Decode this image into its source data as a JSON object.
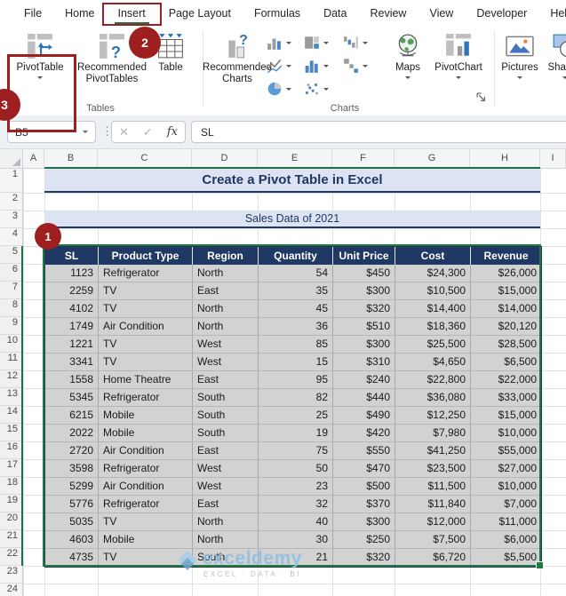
{
  "ribbon": {
    "tabs": [
      "File",
      "Home",
      "Insert",
      "Page Layout",
      "Formulas",
      "Data",
      "Review",
      "View",
      "Developer",
      "Help"
    ],
    "active_tab": "Insert",
    "groups": {
      "tables": {
        "label": "Tables",
        "pivot_table": "PivotTable",
        "recommended_pivottables": "Recommended PivotTables",
        "table": "Table"
      },
      "charts": {
        "label": "Charts",
        "recommended_charts": "Recommended Charts",
        "maps": "Maps",
        "pivot_chart": "PivotChart"
      },
      "illustrations": {
        "pictures": "Pictures",
        "shapes": "Shapes"
      }
    },
    "annotations": {
      "step1": "1",
      "step2": "2",
      "step3": "3"
    }
  },
  "formula_bar": {
    "name_box": "B5",
    "cancel_icon": "✕",
    "enter_icon": "✓",
    "fx_label": "fx",
    "formula": "SL",
    "dots_icon": "⋮"
  },
  "grid": {
    "column_headers": [
      "A",
      "B",
      "C",
      "D",
      "E",
      "F",
      "G",
      "H",
      "I"
    ],
    "row_count": 24,
    "title": "Create a Pivot Table in Excel",
    "subtitle": "Sales Data of 2021"
  },
  "table": {
    "headers": [
      "SL",
      "Product Type",
      "Region",
      "Quantity",
      "Unit Price",
      "Cost",
      "Revenue"
    ],
    "rows": [
      [
        "1123",
        "Refrigerator",
        "North",
        "54",
        "$450",
        "$24,300",
        "$26,000"
      ],
      [
        "2259",
        "TV",
        "East",
        "35",
        "$300",
        "$10,500",
        "$15,000"
      ],
      [
        "4102",
        "TV",
        "North",
        "45",
        "$320",
        "$14,400",
        "$14,000"
      ],
      [
        "1749",
        "Air Condition",
        "North",
        "36",
        "$510",
        "$18,360",
        "$20,120"
      ],
      [
        "1221",
        "TV",
        "West",
        "85",
        "$300",
        "$25,500",
        "$28,500"
      ],
      [
        "3341",
        "TV",
        "West",
        "15",
        "$310",
        "$4,650",
        "$6,500"
      ],
      [
        "1558",
        "Home Theatre",
        "East",
        "95",
        "$240",
        "$22,800",
        "$22,000"
      ],
      [
        "5345",
        "Refrigerator",
        "South",
        "82",
        "$440",
        "$36,080",
        "$33,000"
      ],
      [
        "6215",
        "Mobile",
        "South",
        "25",
        "$490",
        "$12,250",
        "$15,000"
      ],
      [
        "2022",
        "Mobile",
        "South",
        "19",
        "$420",
        "$7,980",
        "$10,000"
      ],
      [
        "2720",
        "Air Condition",
        "East",
        "75",
        "$550",
        "$41,250",
        "$55,000"
      ],
      [
        "3598",
        "Refrigerator",
        "West",
        "50",
        "$470",
        "$23,500",
        "$27,000"
      ],
      [
        "5299",
        "Air Condition",
        "West",
        "23",
        "$500",
        "$11,500",
        "$10,000"
      ],
      [
        "5776",
        "Refrigerator",
        "East",
        "32",
        "$370",
        "$11,840",
        "$7,000"
      ],
      [
        "5035",
        "TV",
        "North",
        "40",
        "$300",
        "$12,000",
        "$11,000"
      ],
      [
        "4603",
        "Mobile",
        "North",
        "30",
        "$250",
        "$7,500",
        "$6,000"
      ],
      [
        "4735",
        "TV",
        "South",
        "21",
        "$320",
        "$6,720",
        "$5,500"
      ]
    ]
  },
  "watermark": {
    "brand": "exceldemy",
    "tagline": "EXCEL · DATA · BI"
  },
  "colors": {
    "accent_green": "#1e7145",
    "annotation_red": "#9e1f1f",
    "header_navy": "#1f3864",
    "band_lavender": "#dde3f2",
    "selection_gray": "#d2d2d2"
  }
}
